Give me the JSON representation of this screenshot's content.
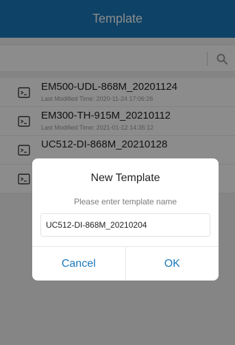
{
  "header": {
    "title": "Template"
  },
  "search": {
    "placeholder": "",
    "icon": "search-icon"
  },
  "templates": [
    {
      "name": "EM500-UDL-868M_20201124",
      "modified": "Last Modified Time: 2020-11-24 17:06:26",
      "icon": "terminal-icon"
    },
    {
      "name": "EM300-TH-915M_20210112",
      "modified": "Last Modified Time: 2021-01-12 14:35:12",
      "icon": "terminal-icon"
    },
    {
      "name": "UC512-DI-868M_20210128",
      "modified": "",
      "icon": "terminal-icon"
    },
    {
      "name": "",
      "modified": "",
      "icon": "terminal-icon"
    }
  ],
  "dialog": {
    "title": "New Template",
    "message": "Please enter template name",
    "input_value": "UC512-DI-868M_20210204",
    "cancel_label": "Cancel",
    "ok_label": "OK"
  },
  "colors": {
    "header_bg": "#1a78bc",
    "accent": "#1a78bc",
    "scrim": "rgba(0,0,0,0.45)"
  }
}
